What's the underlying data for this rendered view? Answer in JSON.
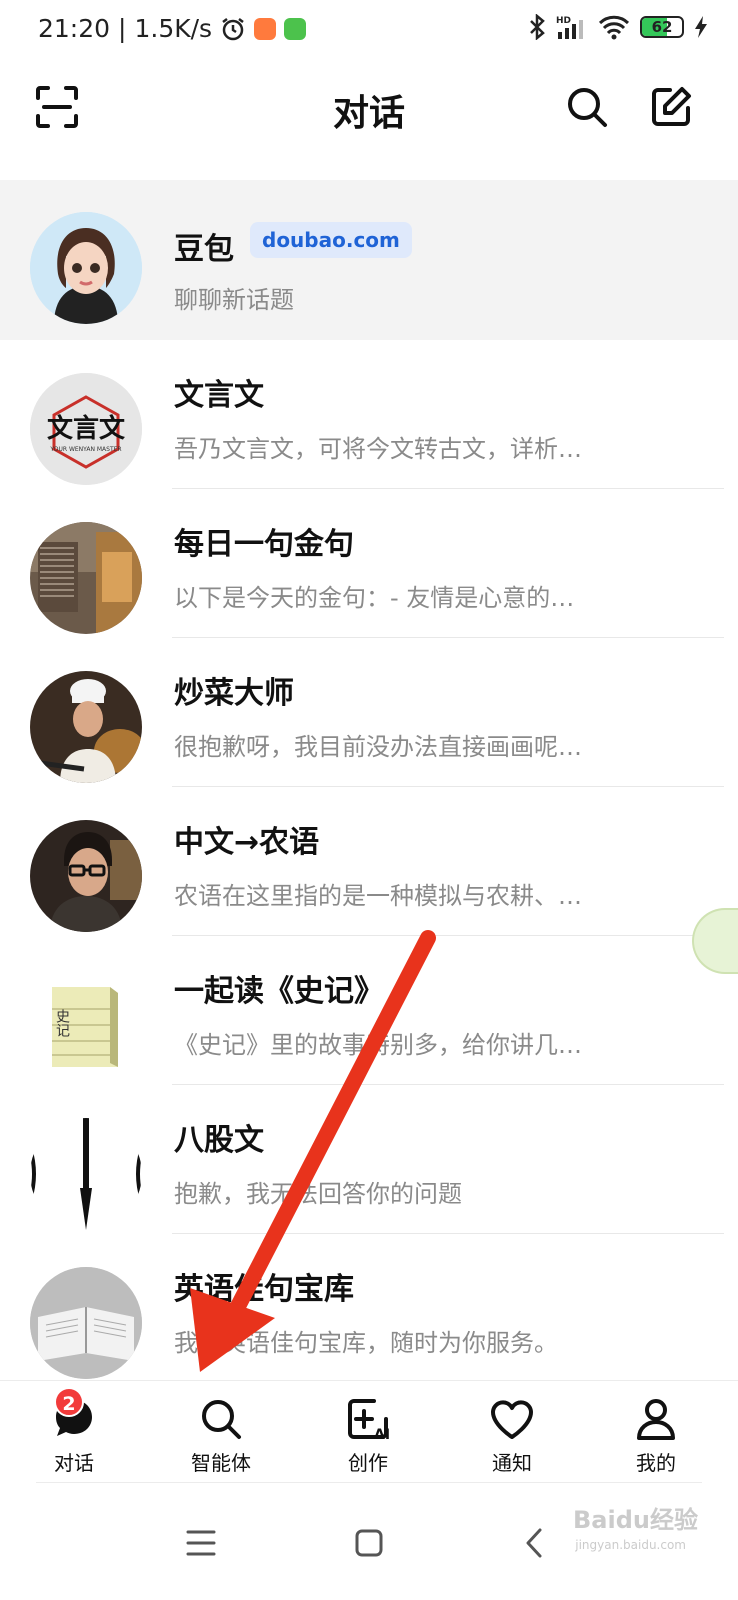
{
  "status_bar": {
    "time": "21:20",
    "network_speed": "1.5K/s",
    "battery": "62",
    "battery_level": 0.62
  },
  "header": {
    "title": "对话"
  },
  "chats": [
    {
      "name": "豆包",
      "tag": "doubao.com",
      "preview": "聊聊新话题"
    },
    {
      "name": "文言文",
      "preview": "吾乃文言文，可将今文转古文，详析…"
    },
    {
      "name": "每日一句金句",
      "preview": "以下是今天的金句：- 友情是心意的…"
    },
    {
      "name": "炒菜大师",
      "preview": "很抱歉呀，我目前没办法直接画画呢…"
    },
    {
      "name": "中文→农语",
      "preview": "农语在这里指的是一种模拟与农耕、…"
    },
    {
      "name": "一起读《史记》",
      "preview": "《史记》里的故事特别多，给你讲几…"
    },
    {
      "name": "八股文",
      "preview": "抱歉，我无法回答你的问题"
    },
    {
      "name": "英语佳句宝库",
      "preview": "我是英语佳句宝库，随时为你服务。"
    }
  ],
  "avatar_texts": {
    "wenyan": "文言文",
    "wenyan_sub": "YOUR WENYAN MASTER",
    "shiji": "史记"
  },
  "bottom_nav": {
    "badge": "2",
    "items": [
      "对话",
      "智能体",
      "创作",
      "通知",
      "我的"
    ]
  },
  "watermark": {
    "main": "Baidu经验",
    "sub": "jingyan.baidu.com"
  },
  "colors": {
    "accent_blue": "#1f63d6",
    "badge_red": "#f23b3b",
    "arrow_red": "#e8331c"
  }
}
